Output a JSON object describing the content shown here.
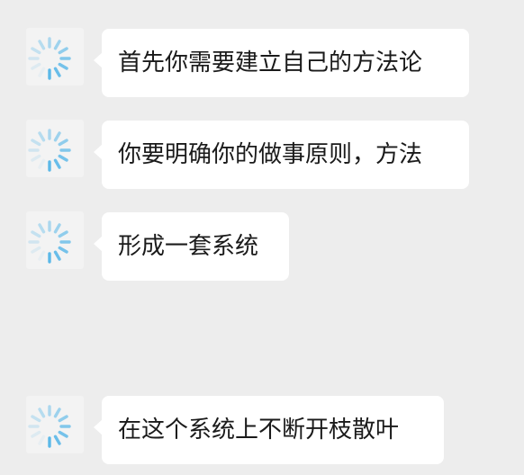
{
  "messages": [
    {
      "text": "首先你需要建立自己的方法论",
      "avatar_icon": "loading-spinner-icon"
    },
    {
      "text": "你要明确你的做事原则，方法",
      "avatar_icon": "loading-spinner-icon"
    },
    {
      "text": "形成一套系统",
      "avatar_icon": "loading-spinner-icon"
    },
    {
      "text": "在这个系统上不断开枝散叶",
      "avatar_icon": "loading-spinner-icon"
    }
  ],
  "colors": {
    "background": "#ededed",
    "bubble": "#ffffff",
    "text": "#1a1a1a",
    "spinner": "#5bb8e8"
  }
}
